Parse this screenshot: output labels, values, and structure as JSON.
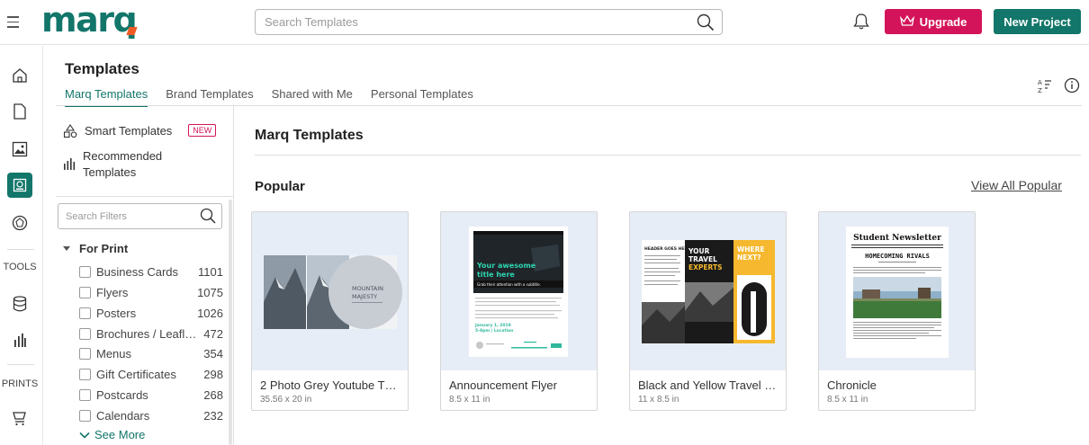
{
  "app": {
    "logo_text": "marq",
    "search_placeholder": "Search Templates",
    "upgrade_label": "Upgrade",
    "new_project_label": "New Project",
    "brand_color": "#12766a",
    "upgrade_color": "#d4145a"
  },
  "rail": {
    "tools_label": "TOOLS",
    "prints_label": "PRINTS",
    "icons": [
      "home-icon",
      "document-icon",
      "image-icon",
      "templates-icon",
      "brand-icon",
      "database-icon",
      "analytics-icon",
      "cart-icon"
    ]
  },
  "header": {
    "title": "Templates",
    "tabs": [
      {
        "label": "Marq Templates",
        "active": true
      },
      {
        "label": "Brand Templates",
        "active": false
      },
      {
        "label": "Shared with Me",
        "active": false
      },
      {
        "label": "Personal Templates",
        "active": false
      }
    ]
  },
  "sidebar": {
    "smart_templates": "Smart Templates",
    "new_badge": "NEW",
    "recommended_line1": "Recommended",
    "recommended_line2": "Templates",
    "filter_placeholder": "Search Filters",
    "group_label": "For Print",
    "categories": [
      {
        "name": "Business Cards",
        "count": "1101"
      },
      {
        "name": "Flyers",
        "count": "1075"
      },
      {
        "name": "Posters",
        "count": "1026"
      },
      {
        "name": "Brochures / Leafl…",
        "count": "472"
      },
      {
        "name": "Menus",
        "count": "354"
      },
      {
        "name": "Gift Certificates",
        "count": "298"
      },
      {
        "name": "Postcards",
        "count": "268"
      },
      {
        "name": "Calendars",
        "count": "232"
      }
    ],
    "see_more": "See More"
  },
  "main": {
    "title": "Marq Templates",
    "section": "Popular",
    "view_all": "View All Popular",
    "cards": [
      {
        "name": "2 Photo Grey Youtube Th…",
        "dims": "35.56 x 20 in",
        "thumb_text": {
          "line1": "MOUNTAIN",
          "line2": "MAJESTY"
        }
      },
      {
        "name": "Announcement Flyer",
        "dims": "8.5 x 11 in",
        "thumb_text": {
          "line1": "Your awesome",
          "line2": "title here",
          "line3": "Grab their attention with a subtitle.",
          "line4": "January 1, 2019",
          "line5": "5-8pm | Location"
        }
      },
      {
        "name": "Black and Yellow Travel …",
        "dims": "11 x 8.5 in",
        "thumb_text": {
          "line1": "HEADER GOES HERE",
          "line2": "YOUR",
          "line3": "TRAVEL",
          "line4": "EXPERTS",
          "line5": "WHERE",
          "line6": "NEXT?"
        }
      },
      {
        "name": "Chronicle",
        "dims": "8.5 x 11 in",
        "thumb_text": {
          "line1": "Student Newsletter",
          "line2": "HOMECOMING RIVALS"
        }
      }
    ]
  }
}
